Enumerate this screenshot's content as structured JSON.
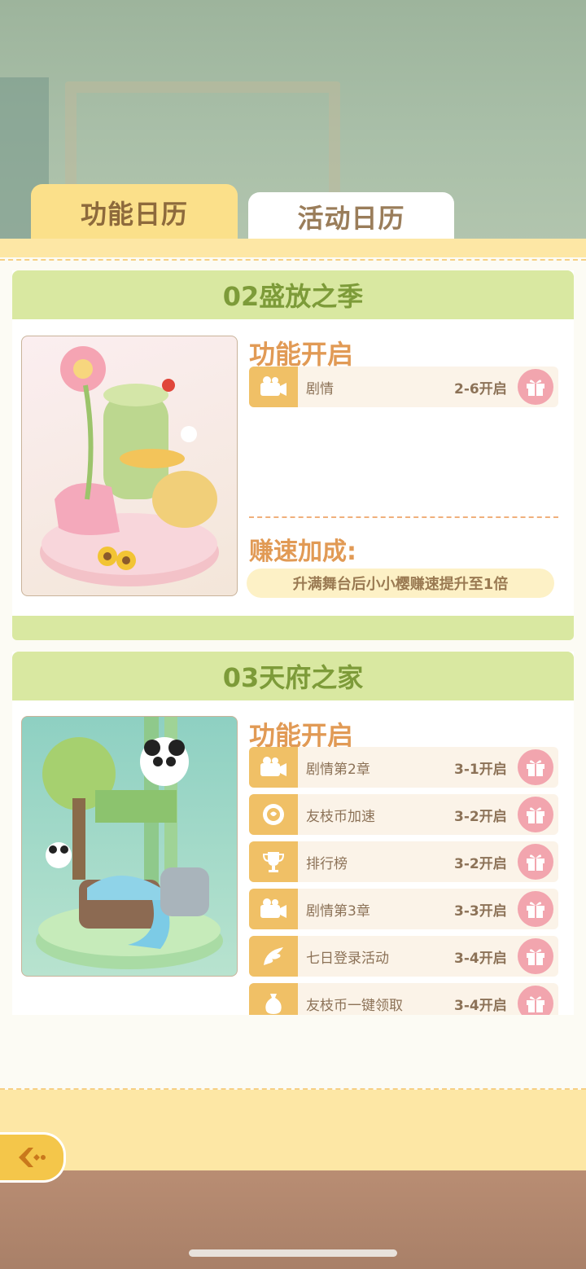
{
  "tabs": [
    {
      "label": "功能日历",
      "active": true
    },
    {
      "label": "活动日历",
      "active": false
    }
  ],
  "sections": [
    {
      "title": "02盛放之季",
      "features_title": "功能开启",
      "features": [
        {
          "name": "剧情",
          "level": "2-6开启",
          "icon": "camera-icon"
        }
      ],
      "speed_title": "赚速加成:",
      "speed_text": "升满舞台后小小樱赚速提升至1倍"
    },
    {
      "title": "03天府之家",
      "features_title": "功能开启",
      "features": [
        {
          "name": "剧情第2章",
          "level": "3-1开启",
          "icon": "camera-icon"
        },
        {
          "name": "友枝币加速",
          "level": "3-2开启",
          "icon": "coin-icon"
        },
        {
          "name": "排行榜",
          "level": "3-2开启",
          "icon": "trophy-icon"
        },
        {
          "name": "剧情第3章",
          "level": "3-3开启",
          "icon": "camera-icon"
        },
        {
          "name": "七日登录活动",
          "level": "3-4开启",
          "icon": "wing-icon"
        },
        {
          "name": "友枝币一键领取",
          "level": "3-4开启",
          "icon": "money-bag-icon"
        }
      ]
    }
  ],
  "colors": {
    "accent_yellow": "#fbe08a",
    "section_header": "#d9e8a1",
    "section_title": "#7d9b39",
    "feature_title": "#e19a55",
    "gift": "#f2a5ae"
  }
}
